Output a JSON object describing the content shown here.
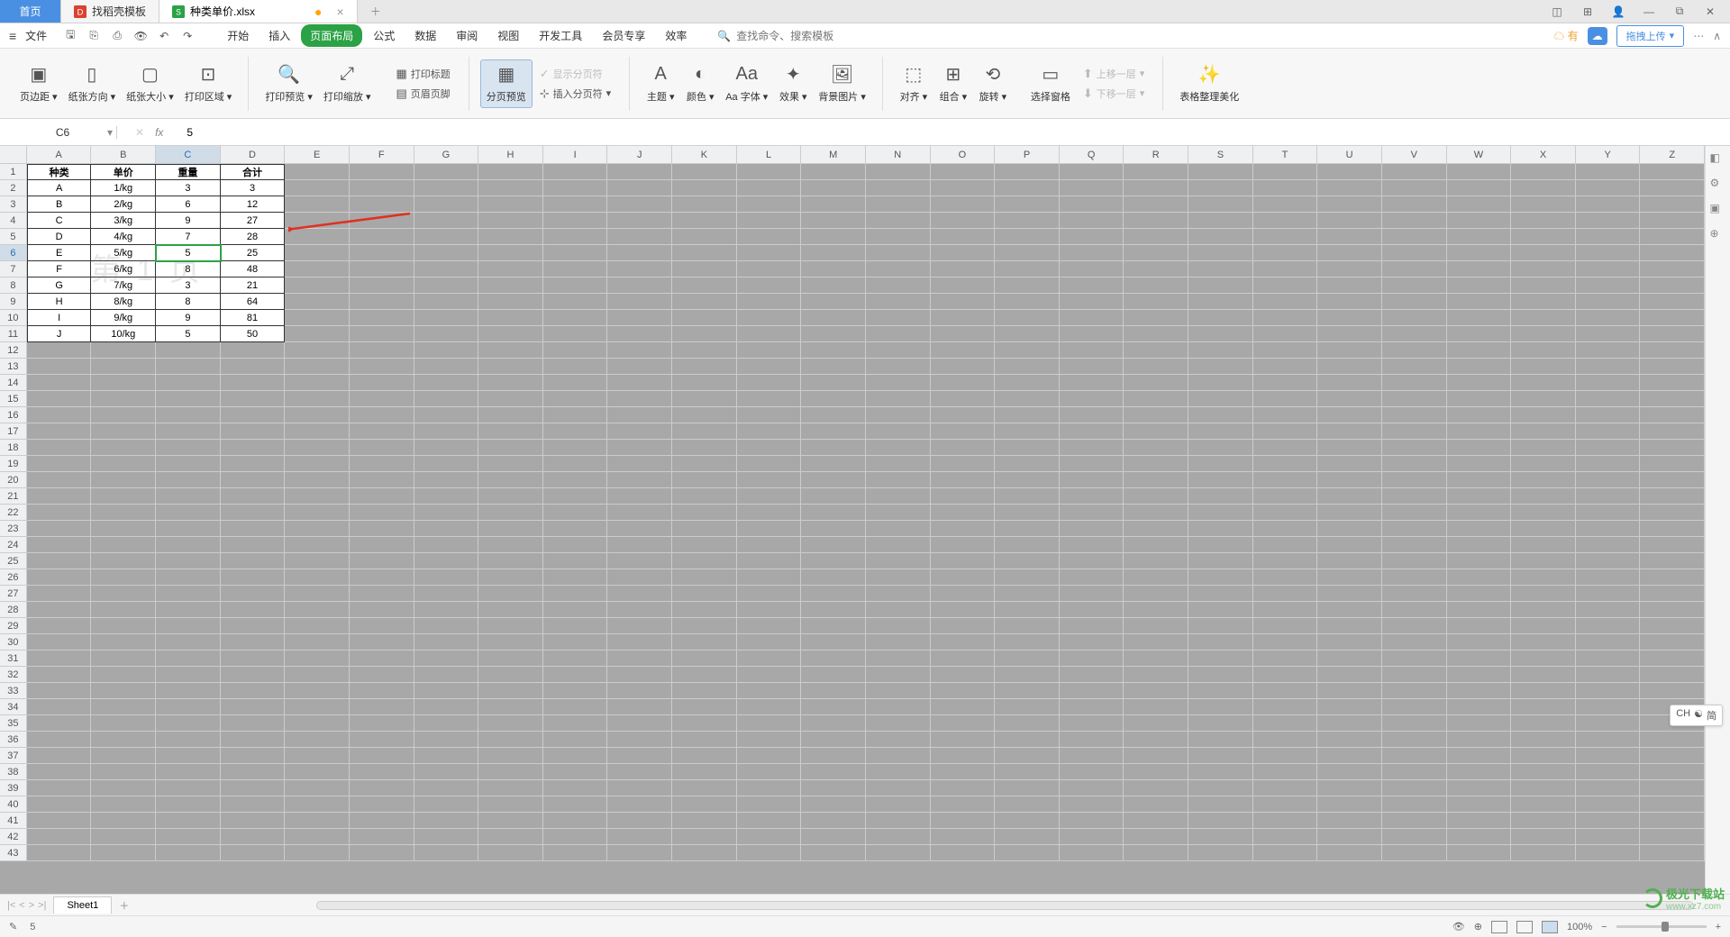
{
  "tabs": {
    "home": "首页",
    "t1": "找稻壳模板",
    "t2": "种类单价.xlsx"
  },
  "menubar": {
    "file": "文件",
    "tabs": [
      "开始",
      "插入",
      "页面布局",
      "公式",
      "数据",
      "审阅",
      "视图",
      "开发工具",
      "会员专享",
      "效率"
    ],
    "active_index": 2,
    "search_placeholder": "查找命令、搜索模板",
    "upload_label": "拖拽上传",
    "cloud_prefix": "有"
  },
  "ribbon": {
    "g1": [
      "页边距",
      "纸张方向",
      "纸张大小",
      "打印区域"
    ],
    "g2": [
      "打印预览",
      "打印缩放"
    ],
    "g2b": {
      "title": "打印标题",
      "header": "页眉页脚"
    },
    "g3": "分页预览",
    "g3b": {
      "show": "显示分页符",
      "insert": "插入分页符"
    },
    "g4": [
      "主题",
      "颜色",
      "Aa 字体",
      "效果",
      "背景图片"
    ],
    "g5": [
      "对齐",
      "组合",
      "旋转"
    ],
    "g6": "选择窗格",
    "g6b": {
      "up": "上移一层",
      "down": "下移一层"
    },
    "g7": "表格整理美化"
  },
  "namebox": "C6",
  "formula": "5",
  "columns": [
    "A",
    "B",
    "C",
    "D",
    "E",
    "F",
    "G",
    "H",
    "I",
    "J",
    "K",
    "L",
    "M",
    "N",
    "O",
    "P",
    "Q",
    "R",
    "S",
    "T",
    "U",
    "V",
    "W",
    "X",
    "Y",
    "Z"
  ],
  "active_col_index": 2,
  "active_row": 6,
  "table": {
    "headers": [
      "种类",
      "单价",
      "重量",
      "合计"
    ],
    "rows": [
      [
        "A",
        "1/kg",
        "3",
        "3"
      ],
      [
        "B",
        "2/kg",
        "6",
        "12"
      ],
      [
        "C",
        "3/kg",
        "9",
        "27"
      ],
      [
        "D",
        "4/kg",
        "7",
        "28"
      ],
      [
        "E",
        "5/kg",
        "5",
        "25"
      ],
      [
        "F",
        "6/kg",
        "8",
        "48"
      ],
      [
        "G",
        "7/kg",
        "3",
        "21"
      ],
      [
        "H",
        "8/kg",
        "8",
        "64"
      ],
      [
        "I",
        "9/kg",
        "9",
        "81"
      ],
      [
        "J",
        "10/kg",
        "5",
        "50"
      ]
    ]
  },
  "watermark": "第 1 页",
  "total_grid_rows": 43,
  "sheet": {
    "name": "Sheet1"
  },
  "status": {
    "left_icon": "✎",
    "value": "5",
    "zoom": "100%"
  },
  "ime": {
    "lang": "CH",
    "mode": "简"
  },
  "corner": {
    "brand": "极光下载站",
    "url": "www.xz7.com"
  }
}
